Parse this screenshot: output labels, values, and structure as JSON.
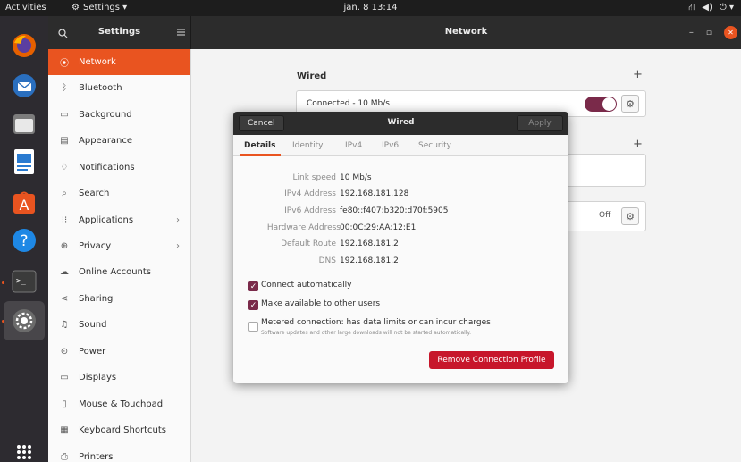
{
  "topbar": {
    "activities": "Activities",
    "app_menu": "Settings ▾",
    "clock": "jan. 8  13:14"
  },
  "dock": {
    "items": [
      {
        "name": "firefox-icon"
      },
      {
        "name": "thunderbird-icon"
      },
      {
        "name": "files-icon"
      },
      {
        "name": "writer-icon"
      },
      {
        "name": "software-icon"
      },
      {
        "name": "help-icon"
      },
      {
        "name": "terminal-icon"
      },
      {
        "name": "settings-icon"
      },
      {
        "name": "show-apps-icon"
      }
    ]
  },
  "header": {
    "sidebar_title": "Settings",
    "main_title": "Network"
  },
  "sidebar": {
    "items": [
      {
        "label": "Network",
        "icon": "⦿"
      },
      {
        "label": "Bluetooth",
        "icon": "ᛒ"
      },
      {
        "label": "Background",
        "icon": "▭"
      },
      {
        "label": "Appearance",
        "icon": "▤"
      },
      {
        "label": "Notifications",
        "icon": "♢"
      },
      {
        "label": "Search",
        "icon": "⌕"
      },
      {
        "label": "Applications",
        "icon": "⁝⁝"
      },
      {
        "label": "Privacy",
        "icon": "⊕"
      },
      {
        "label": "Online Accounts",
        "icon": "☁"
      },
      {
        "label": "Sharing",
        "icon": "⋖"
      },
      {
        "label": "Sound",
        "icon": "♫"
      },
      {
        "label": "Power",
        "icon": "⊙"
      },
      {
        "label": "Displays",
        "icon": "▭"
      },
      {
        "label": "Mouse & Touchpad",
        "icon": "▯"
      },
      {
        "label": "Keyboard Shortcuts",
        "icon": "▦"
      },
      {
        "label": "Printers",
        "icon": "⎙"
      }
    ]
  },
  "main": {
    "wired_title": "Wired",
    "plus": "+",
    "wired_status": "Connected - 10 Mb/s",
    "vpn_toggle_label": "Off"
  },
  "dialog": {
    "cancel": "Cancel",
    "title": "Wired",
    "apply": "Apply",
    "tabs": [
      "Details",
      "Identity",
      "IPv4",
      "IPv6",
      "Security"
    ],
    "details": [
      {
        "label": "Link speed",
        "value": "10 Mb/s"
      },
      {
        "label": "IPv4 Address",
        "value": "192.168.181.128"
      },
      {
        "label": "IPv6 Address",
        "value": "fe80::f407:b320:d70f:5905"
      },
      {
        "label": "Hardware Address",
        "value": "00:0C:29:AA:12:E1"
      },
      {
        "label": "Default Route",
        "value": "192.168.181.2"
      },
      {
        "label": "DNS",
        "value": "192.168.181.2"
      }
    ],
    "connect_auto": "Connect automatically",
    "available_users": "Make available to other users",
    "metered": "Metered connection: has data limits or can incur charges",
    "metered_sub": "Software updates and other large downloads will not be started automatically.",
    "remove": "Remove Connection Profile"
  }
}
